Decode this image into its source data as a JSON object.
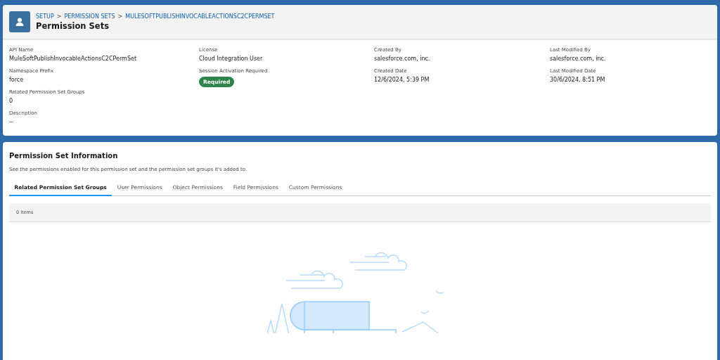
{
  "breadcrumb": [
    "SETUP",
    "PERMISSION SETS",
    "MULESOFTPUBLISHINVOCABLEACTIONSC2CPERMSET"
  ],
  "breadcrumb_separator": ">",
  "title": "Permission Sets",
  "details": [
    [
      {
        "label": "API Name",
        "value": "MuleSoftPublishInvocableActionsC2CPermSet",
        "kind": "text"
      },
      {
        "label": "Namespace Prefix",
        "value": "force",
        "kind": "text"
      },
      {
        "label": "Related Permission Set Groups",
        "value": "0",
        "kind": "text"
      },
      {
        "label": "Description",
        "value": "--",
        "kind": "text"
      }
    ],
    [
      {
        "label": "License",
        "value": "Cloud Integration User",
        "kind": "text"
      },
      {
        "label": "Session Activation Required",
        "value": "Required",
        "kind": "badge"
      }
    ],
    [
      {
        "label": "Created By",
        "value": "salesforce.com, inc.",
        "kind": "text"
      },
      {
        "label": "Created Date",
        "value": "12/6/2024, 5:39 PM",
        "kind": "text"
      }
    ],
    [
      {
        "label": "Last Modified By",
        "value": "salesforce.com, inc.",
        "kind": "text"
      },
      {
        "label": "Last Modified Date",
        "value": "30/6/2024, 8:51 PM",
        "kind": "text"
      }
    ]
  ],
  "section": {
    "title": "Permission Set Information",
    "description": "See the permissions enabled for this permission set and the permission set groups it's added to."
  },
  "tabs": [
    {
      "label": "Related Permission Set Groups",
      "selected": true
    },
    {
      "label": "User Permissions",
      "selected": false
    },
    {
      "label": "Object Permissions",
      "selected": false
    },
    {
      "label": "Field Permissions",
      "selected": false
    },
    {
      "label": "Custom Permissions",
      "selected": false
    }
  ],
  "item_count": "0 items"
}
